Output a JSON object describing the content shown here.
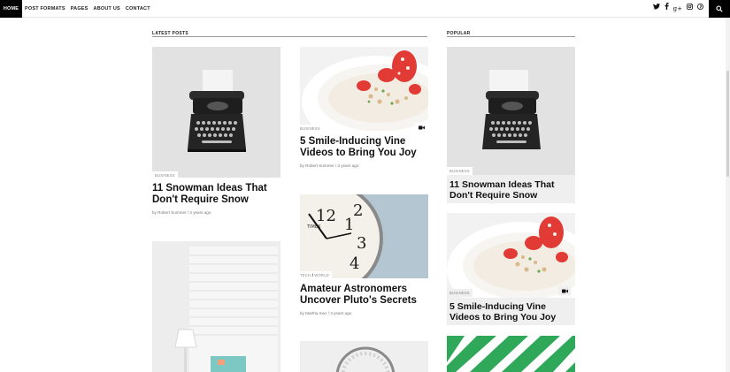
{
  "nav": {
    "home": "HOME",
    "items": [
      "POST FORMATS",
      "PAGES",
      "ABOUT US",
      "CONTACT"
    ]
  },
  "social_icons": [
    "twitter-icon",
    "facebook-icon",
    "google-plus-icon",
    "instagram-icon",
    "pinterest-icon"
  ],
  "search_icon": "search-icon",
  "sections": {
    "latest": "LATEST POSTS",
    "popular": "POPULAR"
  },
  "latest": [
    {
      "category": "BUSINESS",
      "title": "11 Snowman Ideas That Don't Require Snow",
      "meta": "by Robert Summer / 3 years ago"
    },
    {
      "category": "BUSINESS",
      "title": "5 Smile-Inducing Vine Videos to Bring You Joy",
      "meta": "by Robert Summer / 3 years ago"
    },
    {
      "category_a": "TECH",
      "category_sep": " / ",
      "category_b": "WORLD",
      "title": "Amateur Astronomers Uncover Pluto's Secrets",
      "meta": "by Martha Inez / 3 years ago"
    }
  ],
  "popular": [
    {
      "category": "BUSINESS",
      "title": "11 Snowman Ideas That Don't Require Snow"
    },
    {
      "category": "BUSINESS",
      "title": "5 Smile-Inducing Vine Videos to Bring You Joy"
    }
  ],
  "colors": {
    "accent": "#000000",
    "background": "#ffffff",
    "card_gray": "#efefef"
  }
}
